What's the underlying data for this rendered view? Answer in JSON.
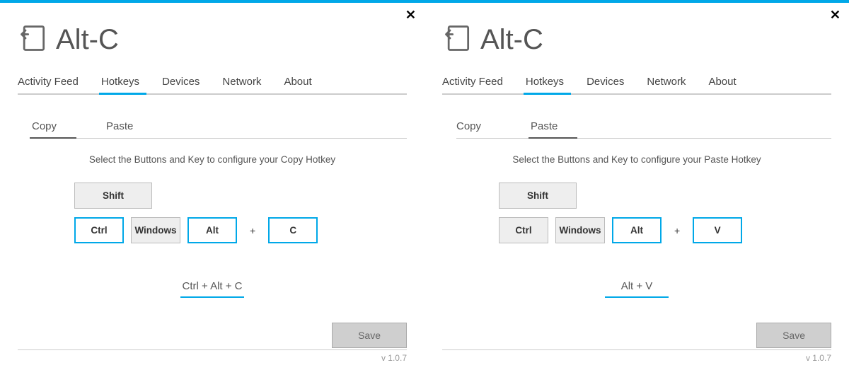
{
  "app": {
    "title": "Alt-C",
    "version": "v 1.0.7"
  },
  "tabs": {
    "activity": "Activity Feed",
    "hotkeys": "Hotkeys",
    "devices": "Devices",
    "network": "Network",
    "about": "About"
  },
  "subtabs": {
    "copy": "Copy",
    "paste": "Paste"
  },
  "keys": {
    "shift": "Shift",
    "ctrl": "Ctrl",
    "windows": "Windows",
    "alt": "Alt",
    "plus": "+"
  },
  "left": {
    "instruction": "Select the Buttons and Key to configure your Copy Hotkey",
    "letter": "C",
    "result": "Ctrl + Alt + C",
    "save": "Save"
  },
  "right": {
    "instruction": "Select the Buttons and Key to configure your Paste Hotkey",
    "letter": "V",
    "result": "Alt + V",
    "save": "Save"
  }
}
